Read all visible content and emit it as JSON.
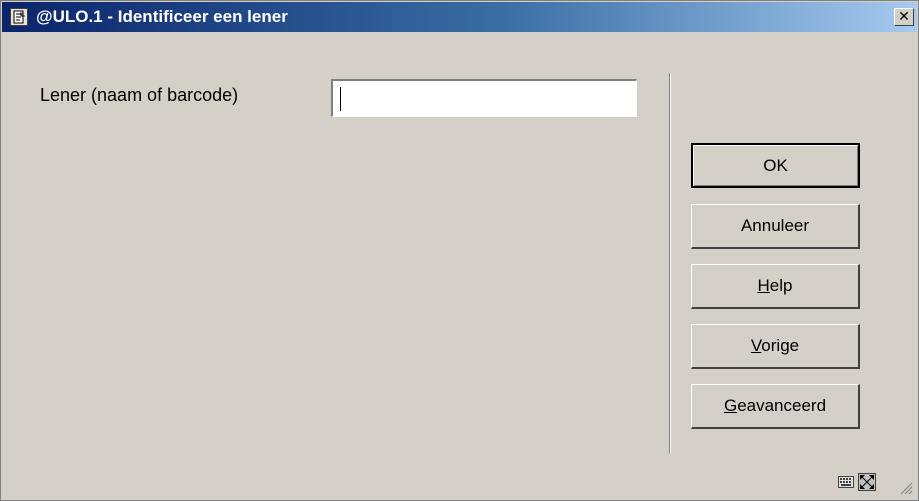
{
  "window": {
    "title": "@ULO.1 - Identificeer een lener",
    "icons": {
      "app": "document-icon",
      "close": "close-icon"
    }
  },
  "form": {
    "lener_label": "Lener (naam of barcode)",
    "lener_value": ""
  },
  "buttons": {
    "ok": "OK",
    "annuleer": "Annuleer",
    "help": {
      "accel": "H",
      "rest": "elp"
    },
    "vorige": {
      "accel": "V",
      "rest": "orige"
    },
    "geavanceerd": {
      "accel": "G",
      "rest": "eavanceerd"
    }
  },
  "statusbar": {
    "icons": [
      "keyboard-icon",
      "fullscreen-icon",
      "resize-grip-icon"
    ]
  },
  "colors": {
    "title_start": "#0a246a",
    "title_end": "#a6caf0",
    "dialog_bg": "#d4d0c8"
  }
}
